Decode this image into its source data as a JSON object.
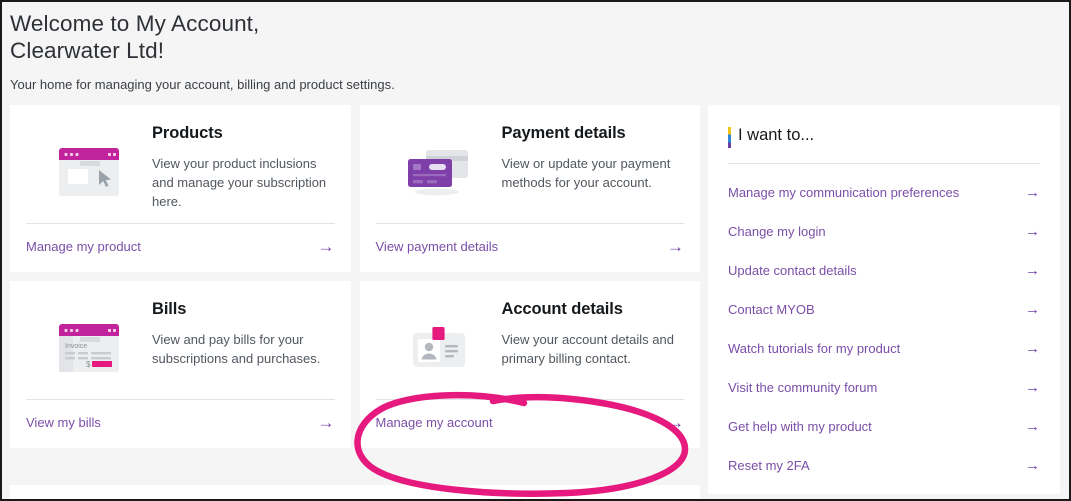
{
  "header": {
    "title": "Welcome to My Account,\nClearwater Ltd!",
    "subtitle": "Your home for managing your account, billing and product settings."
  },
  "cards": [
    {
      "icon": "browser-window-icon",
      "title": "Products",
      "description": "View your product inclusions and manage your subscription here.",
      "link_label": "Manage my product",
      "arrow": "→"
    },
    {
      "icon": "credit-cards-icon",
      "title": "Payment details",
      "description": "View or update your payment methods for your account.",
      "link_label": "View payment details",
      "arrow": "→"
    },
    {
      "icon": "invoice-icon",
      "title": "Bills",
      "description": "View and pay bills for your subscriptions and purchases.",
      "link_label": "View my bills",
      "arrow": "→"
    },
    {
      "icon": "id-badge-icon",
      "title": "Account details",
      "description": "View your account details and primary billing contact.",
      "link_label": "Manage my account",
      "arrow": "→"
    }
  ],
  "sidebar": {
    "title": "I want to...",
    "links": [
      {
        "label": "Manage my communication preferences",
        "arrow": "→"
      },
      {
        "label": "Change my login",
        "arrow": "→"
      },
      {
        "label": "Update contact details",
        "arrow": "→"
      },
      {
        "label": "Contact MYOB",
        "arrow": "→"
      },
      {
        "label": "Watch tutorials for my product",
        "arrow": "→"
      },
      {
        "label": "Visit the community forum",
        "arrow": "→"
      },
      {
        "label": "Get help with my product",
        "arrow": "→"
      },
      {
        "label": "Reset my 2FA",
        "arrow": "→"
      }
    ]
  },
  "annotation": {
    "shape": "hand-drawn-ellipse",
    "color": "#E5197E",
    "target": "Manage my account"
  },
  "colors": {
    "page_background": "#f5f5f6",
    "card_background": "#ffffff",
    "link_purple": "#7b4ea8",
    "title_dark": "#16191c",
    "body_grey": "#50575e",
    "icon_magenta": "#c0239b",
    "icon_purple": "#7e3fa8",
    "icon_pink": "#e5197e",
    "annotation_pink": "#E5197E"
  }
}
